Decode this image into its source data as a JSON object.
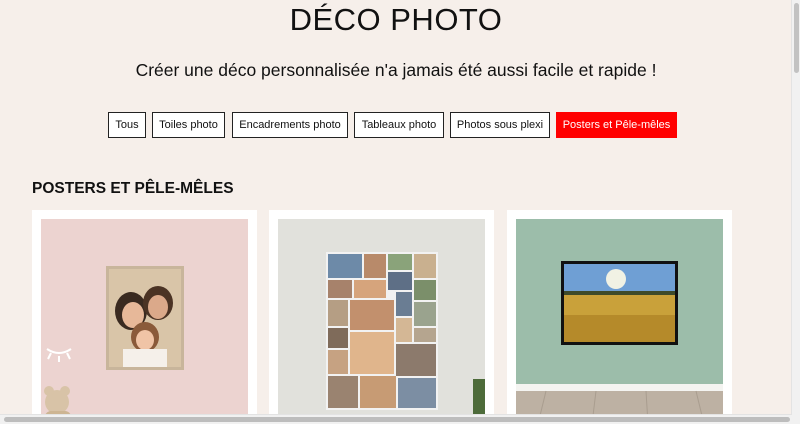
{
  "page": {
    "title": "DÉCO PHOTO",
    "subtitle": "Créer une déco personnalisée n'a jamais été aussi facile et rapide !"
  },
  "filters": [
    {
      "label": "Tous",
      "active": false
    },
    {
      "label": "Toiles photo",
      "active": false
    },
    {
      "label": "Encadrements photo",
      "active": false
    },
    {
      "label": "Tableaux photo",
      "active": false
    },
    {
      "label": "Photos sous plexi",
      "active": false
    },
    {
      "label": "Posters et Pêle-mêles",
      "active": true
    }
  ],
  "section": {
    "title": "POSTERS ET PÊLE-MÊLES"
  },
  "colors": {
    "accent": "#ff0000",
    "background": "#f6efea"
  }
}
